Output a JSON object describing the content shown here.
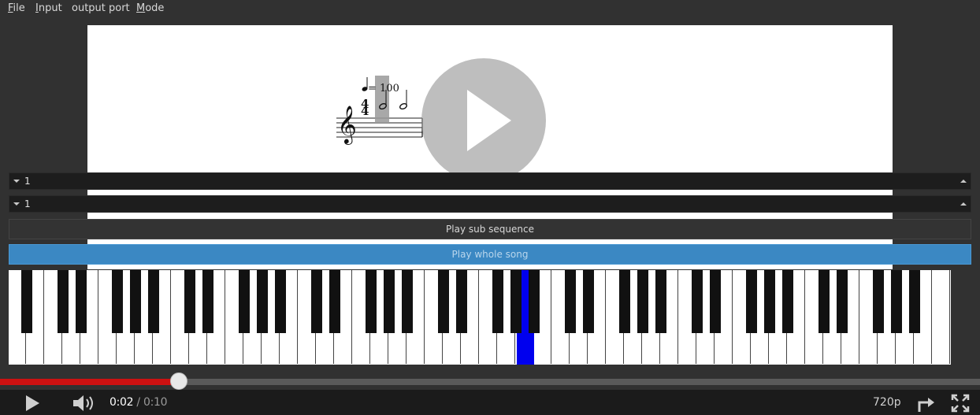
{
  "menu": {
    "items": [
      {
        "first": "F",
        "rest": "ile"
      },
      {
        "first": "I",
        "rest": "nput"
      },
      {
        "first": "",
        "rest": "output port"
      },
      {
        "first": "M",
        "rest": "ode"
      }
    ]
  },
  "score": {
    "tempo_text": "= 100",
    "time_signature": {
      "top": "4",
      "bottom": "4"
    },
    "notes": [
      "half-note",
      "half-note"
    ]
  },
  "spinners": [
    {
      "value": "1"
    },
    {
      "value": "1"
    }
  ],
  "buttons": {
    "play_sub": "Play sub sequence",
    "play_whole": "Play whole song"
  },
  "piano": {
    "white_key_count": 52,
    "highlighted_key": "white key #29",
    "highlight_color": "#0000ee"
  },
  "player": {
    "progress_fraction": 0.2,
    "current_time": "0:02",
    "separator": " / ",
    "total_time": "0:10",
    "quality": "720p",
    "played_color": "#cc1111",
    "icons": [
      "play-icon",
      "volume-icon",
      "share-icon",
      "fullscreen-icon"
    ]
  }
}
